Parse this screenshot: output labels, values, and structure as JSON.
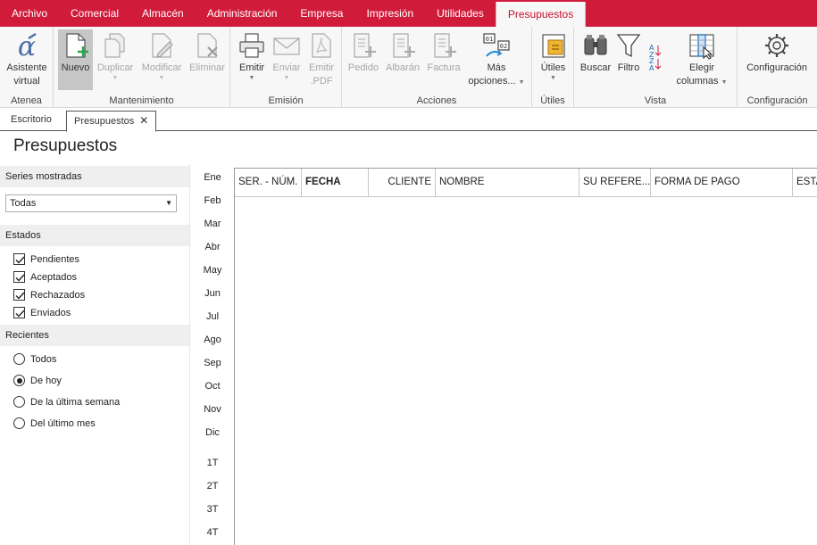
{
  "menu": [
    "Archivo",
    "Comercial",
    "Almacén",
    "Administración",
    "Empresa",
    "Impresión",
    "Utilidades",
    "Presupuestos"
  ],
  "ribbon": {
    "atenea": {
      "label": "Atenea",
      "asistente": [
        "Asistente",
        "virtual"
      ]
    },
    "mantenimiento": {
      "label": "Mantenimiento",
      "nuevo": "Nuevo",
      "duplicar": "Duplicar",
      "modificar": "Modificar",
      "eliminar": "Eliminar"
    },
    "emision": {
      "label": "Emisión",
      "emitir": "Emitir",
      "enviar": "Enviar",
      "emitir_pdf": [
        "Emitir",
        ".PDF"
      ]
    },
    "acciones": {
      "label": "Acciones",
      "pedido": "Pedido",
      "albaran": "Albarán",
      "factura": "Factura",
      "mas": [
        "Más",
        "opciones..."
      ]
    },
    "utiles": {
      "label": "Útiles",
      "utiles": "Útiles"
    },
    "vista": {
      "label": "Vista",
      "buscar": "Buscar",
      "filtro": "Filtro",
      "elegir": [
        "Elegir",
        "columnas"
      ]
    },
    "configuracion": {
      "label": "Configuración",
      "configuracion": "Configuración"
    }
  },
  "tabs": {
    "escritorio": "Escritorio",
    "presupuestos": "Presupuestos"
  },
  "page_title": "Presupuestos",
  "filters": {
    "series_label": "Series mostradas",
    "series_value": "Todas",
    "estados_label": "Estados",
    "estados": [
      "Pendientes",
      "Aceptados",
      "Rechazados",
      "Enviados"
    ],
    "recientes_label": "Recientes",
    "recientes": [
      "Todos",
      "De hoy",
      "De la última semana",
      "Del último mes"
    ],
    "recientes_selected": "De hoy"
  },
  "months": [
    "Ene",
    "Feb",
    "Mar",
    "Abr",
    "May",
    "Jun",
    "Jul",
    "Ago",
    "Sep",
    "Oct",
    "Nov",
    "Dic"
  ],
  "quarters": [
    "1T",
    "2T",
    "3T",
    "4T"
  ],
  "columns": [
    "SER. - NÚM.",
    "FECHA",
    "CLIENTE",
    "NOMBRE",
    "SU REFERE...",
    "FORMA DE PAGO",
    "ESTA"
  ],
  "colors": {
    "brand": "#d11b3b",
    "ribbon_bg": "#f7f7f7",
    "pressed": "#c6c6c6"
  }
}
